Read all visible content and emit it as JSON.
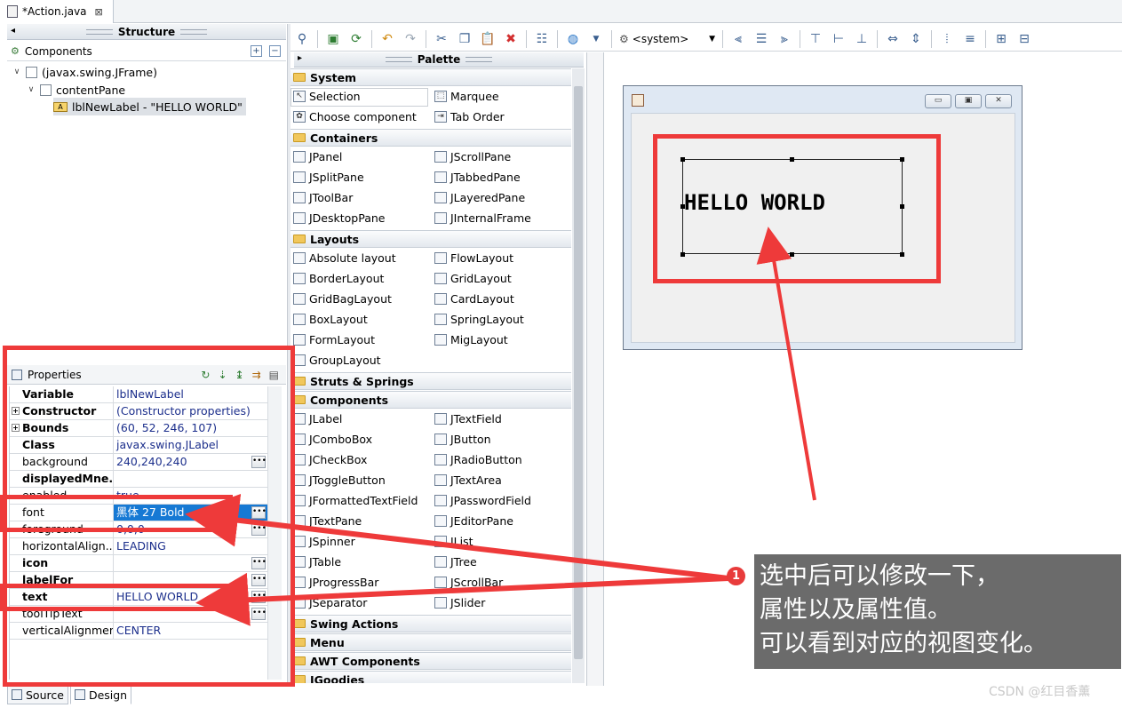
{
  "editor": {
    "tab_title": "*Action.java",
    "close": "⊠"
  },
  "structure": {
    "header": "Structure",
    "components_label": "Components",
    "tree": [
      {
        "label": "(javax.swing.JFrame)"
      },
      {
        "label": "contentPane"
      },
      {
        "label": "lblNewLabel - \"HELLO WORLD\""
      }
    ]
  },
  "properties": {
    "label": "Properties",
    "rows": [
      {
        "name": "Variable",
        "value": "lblNewLabel",
        "bold": true,
        "expand": false,
        "dots": false
      },
      {
        "name": "Constructor",
        "value": "(Constructor properties)",
        "bold": true,
        "expand": true,
        "dots": false
      },
      {
        "name": "Bounds",
        "value": "(60, 52, 246, 107)",
        "bold": true,
        "expand": true,
        "dots": false
      },
      {
        "name": "Class",
        "value": "javax.swing.JLabel",
        "bold": true,
        "expand": false,
        "dots": false
      },
      {
        "name": "background",
        "value": "240,240,240",
        "bold": false,
        "expand": false,
        "dots": true
      },
      {
        "name": "displayedMne...",
        "value": "",
        "bold": true,
        "expand": false,
        "dots": false
      },
      {
        "name": "enabled",
        "value": "true",
        "bold": false,
        "expand": false,
        "dots": false
      },
      {
        "name": "font",
        "value": "黑体 27 Bold",
        "bold": false,
        "expand": false,
        "dots": true,
        "selected": true
      },
      {
        "name": "foreground",
        "value": "0,0,0",
        "bold": false,
        "expand": false,
        "dots": true
      },
      {
        "name": "horizontalAlign...",
        "value": "LEADING",
        "bold": false,
        "expand": false,
        "dots": false
      },
      {
        "name": "icon",
        "value": "",
        "bold": true,
        "expand": false,
        "dots": true
      },
      {
        "name": "labelFor",
        "value": "",
        "bold": true,
        "expand": false,
        "dots": true
      },
      {
        "name": "text",
        "value": "HELLO WORLD",
        "bold": true,
        "expand": false,
        "dots": true
      },
      {
        "name": "toolTipText",
        "value": "",
        "bold": false,
        "expand": false,
        "dots": true
      },
      {
        "name": "verticalAlignment",
        "value": "CENTER",
        "bold": false,
        "expand": false,
        "dots": false
      }
    ]
  },
  "bottom_tabs": [
    "Source",
    "Design"
  ],
  "toolbar": {
    "combo_value": "<system>"
  },
  "palette": {
    "header": "Palette",
    "categories": [
      {
        "name": "System",
        "items": [
          "Selection",
          "Marquee",
          "Choose component",
          "Tab Order"
        ]
      },
      {
        "name": "Containers",
        "items": [
          "JPanel",
          "JScrollPane",
          "JSplitPane",
          "JTabbedPane",
          "JToolBar",
          "JLayeredPane",
          "JDesktopPane",
          "JInternalFrame"
        ]
      },
      {
        "name": "Layouts",
        "items": [
          "Absolute layout",
          "FlowLayout",
          "BorderLayout",
          "GridLayout",
          "GridBagLayout",
          "CardLayout",
          "BoxLayout",
          "SpringLayout",
          "FormLayout",
          "MigLayout",
          "GroupLayout"
        ]
      },
      {
        "name": "Struts & Springs",
        "items": []
      },
      {
        "name": "Components",
        "items": [
          "JLabel",
          "JTextField",
          "JComboBox",
          "JButton",
          "JCheckBox",
          "JRadioButton",
          "JToggleButton",
          "JTextArea",
          "JFormattedTextField",
          "JPasswordField",
          "JTextPane",
          "JEditorPane",
          "JSpinner",
          "JList",
          "JTable",
          "JTree",
          "JProgressBar",
          "JScrollBar",
          "JSeparator",
          "JSlider"
        ]
      },
      {
        "name": "Swing Actions",
        "items": []
      },
      {
        "name": "Menu",
        "items": []
      },
      {
        "name": "AWT Components",
        "items": []
      },
      {
        "name": "JGoodies",
        "items": []
      }
    ]
  },
  "design": {
    "label_text": "HELLO WORLD"
  },
  "annotation": {
    "number": "1",
    "lines": [
      "选中后可以修改一下，",
      "属性以及属性值。",
      "可以看到对应的视图变化。"
    ],
    "color": "#ee3a3a"
  },
  "watermark": "CSDN @红目香薰"
}
